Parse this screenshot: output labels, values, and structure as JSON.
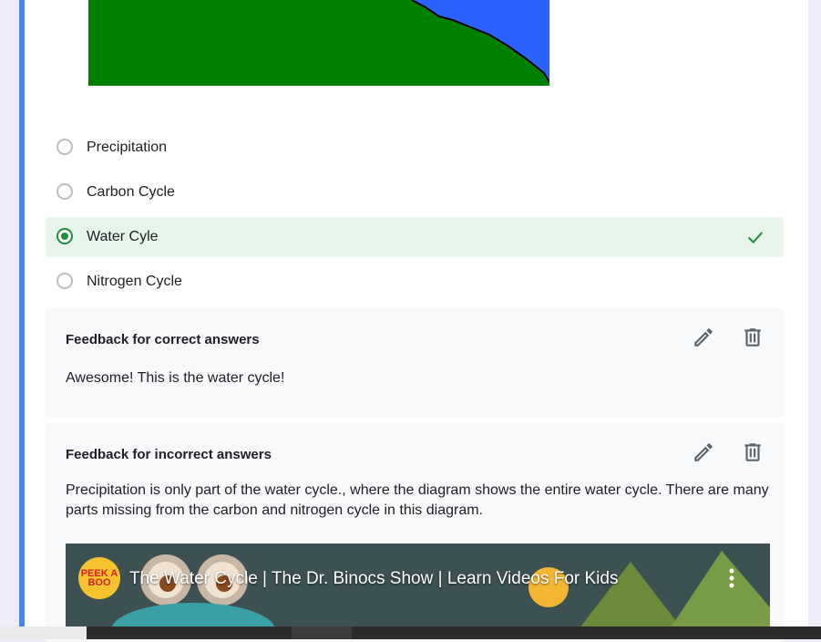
{
  "question": {
    "image_icon": "water-cycle-diagram",
    "options": [
      {
        "label": "Precipitation",
        "selected": false,
        "correct": false
      },
      {
        "label": "Carbon Cycle",
        "selected": false,
        "correct": false
      },
      {
        "label": "Water Cyle",
        "selected": true,
        "correct": true
      },
      {
        "label": "Nitrogen Cycle",
        "selected": false,
        "correct": false
      }
    ],
    "correct_icon": "checkmark-icon"
  },
  "feedback_correct": {
    "title": "Feedback for correct answers",
    "text": "Awesome! This is the water cycle!",
    "edit_icon": "pencil-icon",
    "delete_icon": "trash-icon"
  },
  "feedback_incorrect": {
    "title": "Feedback for incorrect answers",
    "text": "Precipitation is only part of the water cycle., where the diagram shows the entire water cycle. There are many parts missing from the carbon and nitrogen cycle in this diagram.",
    "edit_icon": "pencil-icon",
    "delete_icon": "trash-icon",
    "video": {
      "title": "The Water Cycle | The Dr. Binocs Show | Learn Videos For Kids",
      "channel_logo_text": "PEEK A BOO",
      "menu_icon": "more-vert-icon"
    }
  },
  "colors": {
    "accent": "#4285f4",
    "correct_green": "#1e8e3e",
    "correct_bg": "#e6f4ea",
    "page_bg": "#f0ebf8"
  }
}
